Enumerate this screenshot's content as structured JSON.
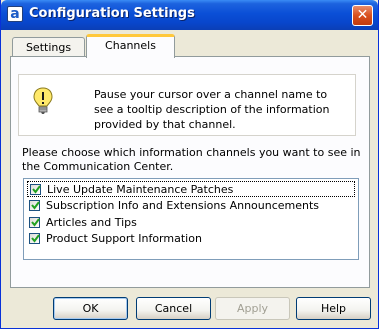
{
  "window": {
    "title": "Configuration Settings",
    "app_icon_glyph": "a",
    "close_glyph": "✕"
  },
  "tabs": [
    {
      "label": "Settings",
      "selected": false
    },
    {
      "label": "Channels",
      "selected": true
    }
  ],
  "info": {
    "icon": "lightbulb-icon",
    "text": "Pause your cursor over a channel name to see a tooltip description of the information provided by that channel."
  },
  "prompt": "Please choose which information channels you want to see in the Communication Center.",
  "channels": [
    {
      "label": "Live Update Maintenance Patches",
      "checked": true,
      "focused": true
    },
    {
      "label": "Subscription Info and Extensions Announcements",
      "checked": true,
      "focused": false
    },
    {
      "label": "Articles and Tips",
      "checked": true,
      "focused": false
    },
    {
      "label": "Product Support Information",
      "checked": true,
      "focused": false
    }
  ],
  "buttons": {
    "ok": "OK",
    "cancel": "Cancel",
    "apply": "Apply",
    "help": "Help"
  },
  "colors": {
    "titlebar": "#0a4fd7",
    "dialog_bg": "#ECE9D8",
    "tab_highlight": "#ffc83c",
    "check": "#21a121"
  }
}
